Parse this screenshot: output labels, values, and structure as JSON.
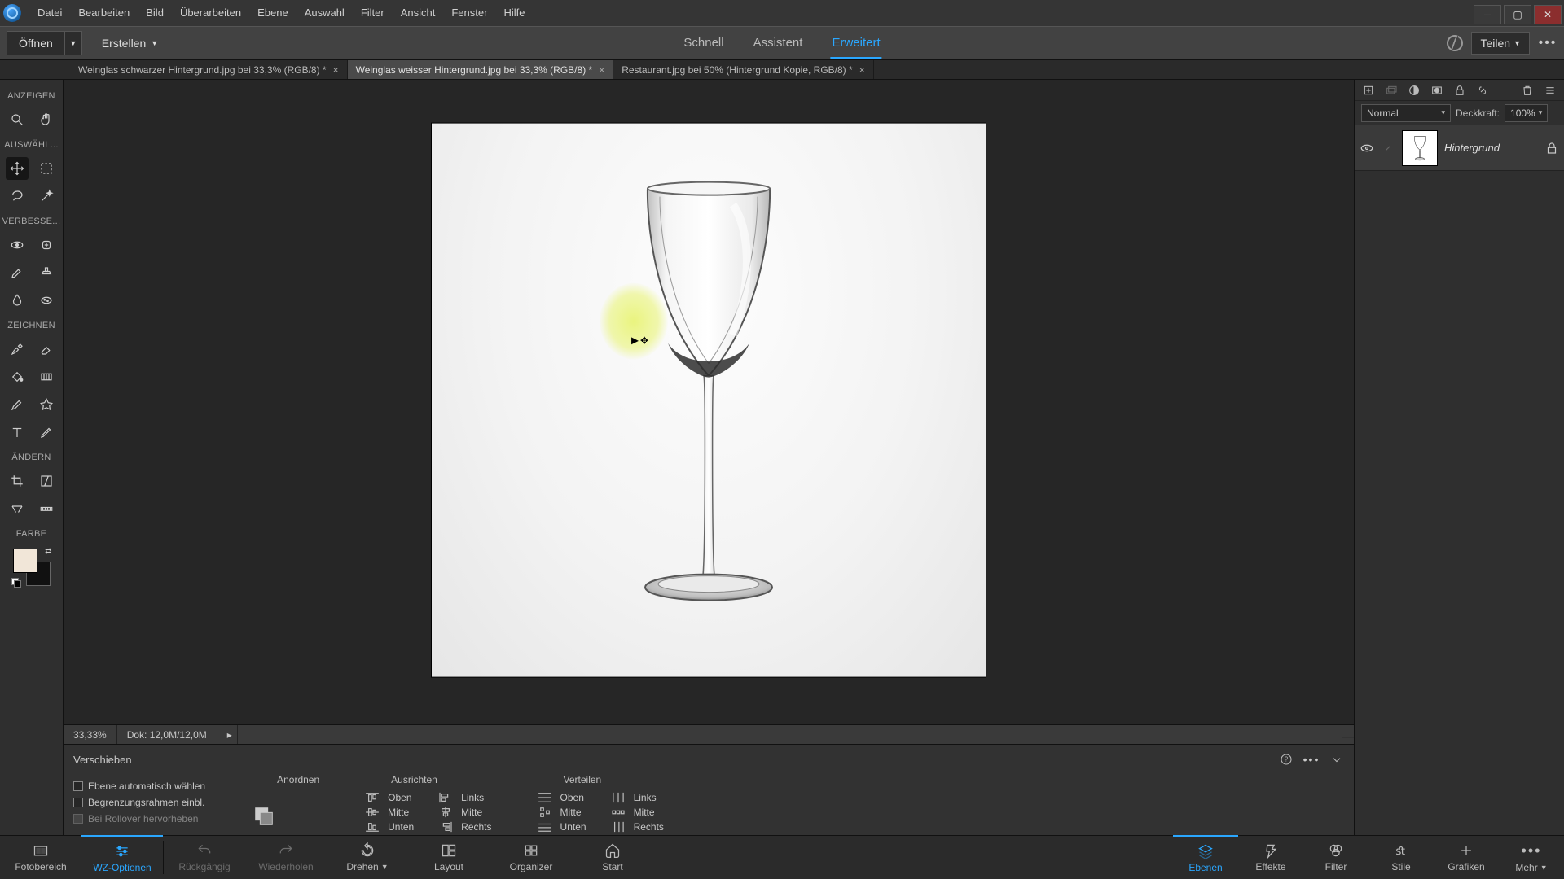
{
  "menu": {
    "items": [
      "Datei",
      "Bearbeiten",
      "Bild",
      "Überarbeiten",
      "Ebene",
      "Auswahl",
      "Filter",
      "Ansicht",
      "Fenster",
      "Hilfe"
    ]
  },
  "actionbar": {
    "open": "Öffnen",
    "create": "Erstellen",
    "modes": {
      "quick": "Schnell",
      "assistant": "Assistent",
      "advanced": "Erweitert"
    },
    "share": "Teilen"
  },
  "doctabs": [
    {
      "label": "Weinglas schwarzer Hintergrund.jpg bei 33,3% (RGB/8) *"
    },
    {
      "label": "Weinglas weisser Hintergrund.jpg bei 33,3% (RGB/8) *"
    },
    {
      "label": "Restaurant.jpg bei 50% (Hintergrund Kopie, RGB/8) *"
    }
  ],
  "active_doctab": 1,
  "toolbox": {
    "sections": {
      "view": "ANZEIGEN",
      "select": "AUSWÄHL...",
      "enhance": "VERBESSE...",
      "draw": "ZEICHNEN",
      "modify": "ÄNDERN",
      "color": "FARBE"
    }
  },
  "status": {
    "zoom": "33,33%",
    "doc": "Dok: 12,0M/12,0M"
  },
  "layers": {
    "blend_mode": "Normal",
    "opacity_label": "Deckkraft:",
    "opacity_value": "100%",
    "items": [
      {
        "name": "Hintergrund"
      }
    ]
  },
  "options": {
    "title": "Verschieben",
    "checks": {
      "auto": "Ebene automatisch wählen",
      "bounds": "Begrenzungsrahmen einbl.",
      "rollover": "Bei Rollover hervorheben"
    },
    "arrange": "Anordnen",
    "align": {
      "title": "Ausrichten",
      "top": "Oben",
      "middle": "Mitte",
      "bottom": "Unten",
      "left": "Links",
      "center": "Mitte",
      "right": "Rechts"
    },
    "distribute": {
      "title": "Verteilen",
      "top": "Oben",
      "middle": "Mitte",
      "bottom": "Unten",
      "left": "Links",
      "center": "Mitte",
      "right": "Rechts"
    }
  },
  "taskbar": {
    "left": {
      "photobin": "Fotobereich",
      "tooloptions": "WZ-Optionen",
      "undo": "Rückgängig",
      "redo": "Wiederholen",
      "rotate": "Drehen",
      "layout": "Layout",
      "organizer": "Organizer",
      "home": "Start"
    },
    "right": {
      "layers": "Ebenen",
      "effects": "Effekte",
      "filters": "Filter",
      "styles": "Stile",
      "graphics": "Grafiken",
      "more": "Mehr"
    }
  }
}
